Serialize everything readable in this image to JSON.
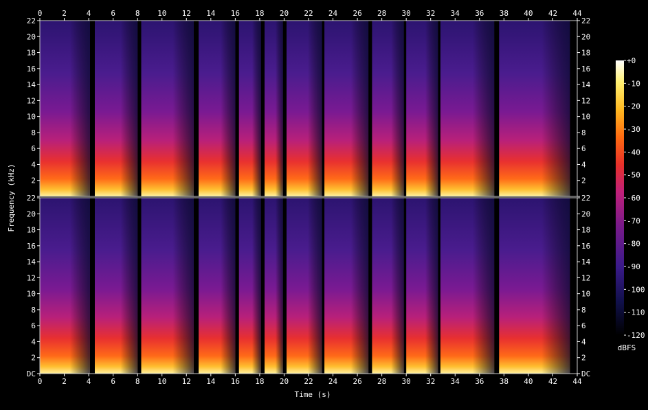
{
  "chart_data": {
    "type": "heatmap",
    "title": "",
    "xlabel": "Time (s)",
    "ylabel": "Frequency (kHz)",
    "xlim": [
      0,
      44
    ],
    "ylim": [
      0,
      22
    ],
    "x_ticks": [
      0,
      2,
      4,
      6,
      8,
      10,
      12,
      14,
      16,
      18,
      20,
      22,
      24,
      26,
      28,
      30,
      32,
      34,
      36,
      38,
      40,
      42,
      44
    ],
    "y_ticks": [
      0,
      2,
      4,
      6,
      8,
      10,
      12,
      14,
      16,
      18,
      20,
      22
    ],
    "y_tick_labels_top": [
      "",
      "2",
      "4",
      "6",
      "8",
      "10",
      "12",
      "14",
      "16",
      "18",
      "20",
      "22"
    ],
    "y_tick_labels_bottom": [
      "DC",
      "2",
      "4",
      "6",
      "8",
      "10",
      "12",
      "14",
      "16",
      "18",
      "20",
      "22"
    ],
    "channels": 2,
    "colorbar": {
      "label": "dBFS",
      "range": [
        -120,
        0
      ],
      "ticks": [
        "+0",
        "-10",
        "-20",
        "-30",
        "-40",
        "-50",
        "-60",
        "-70",
        "-80",
        "-90",
        "-100",
        "-110",
        "-120"
      ]
    },
    "segments": [
      {
        "start": 0.0,
        "end": 4.1
      },
      {
        "start": 4.5,
        "end": 8.0
      },
      {
        "start": 8.3,
        "end": 12.6
      },
      {
        "start": 13.0,
        "end": 16.0
      },
      {
        "start": 16.3,
        "end": 18.1
      },
      {
        "start": 18.4,
        "end": 19.9
      },
      {
        "start": 20.2,
        "end": 23.1
      },
      {
        "start": 23.3,
        "end": 26.9
      },
      {
        "start": 27.2,
        "end": 29.8
      },
      {
        "start": 30.0,
        "end": 32.6
      },
      {
        "start": 32.8,
        "end": 37.2
      },
      {
        "start": 37.6,
        "end": 43.4
      }
    ]
  }
}
